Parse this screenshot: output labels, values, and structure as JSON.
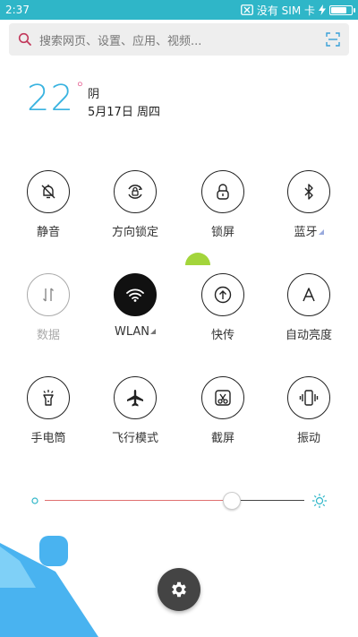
{
  "status_bar": {
    "time": "2:37",
    "sim_text": "没有 SIM 卡",
    "accent": "#2fb6c8",
    "battery_level_percent": 80
  },
  "search": {
    "placeholder": "搜索网页、设置、应用、视频..."
  },
  "weather": {
    "temperature": "22",
    "degree": "°",
    "condition": "阴",
    "date": "5月17日 周四"
  },
  "toggles": [
    {
      "label": "静音",
      "icon": "bell-off-icon",
      "state": "off"
    },
    {
      "label": "方向锁定",
      "icon": "rotation-lock-icon",
      "state": "off"
    },
    {
      "label": "锁屏",
      "icon": "lock-icon",
      "state": "off"
    },
    {
      "label": "蓝牙",
      "icon": "bluetooth-icon",
      "state": "off",
      "has_menu": true
    },
    {
      "label": "数据",
      "icon": "data-arrows-icon",
      "state": "disabled"
    },
    {
      "label": "WLAN",
      "icon": "wifi-icon",
      "state": "on",
      "has_menu": true
    },
    {
      "label": "快传",
      "icon": "share-up-icon",
      "state": "off"
    },
    {
      "label": "自动亮度",
      "icon": "auto-brightness-icon",
      "state": "off"
    },
    {
      "label": "手电筒",
      "icon": "flashlight-icon",
      "state": "off"
    },
    {
      "label": "飞行模式",
      "icon": "airplane-icon",
      "state": "off"
    },
    {
      "label": "截屏",
      "icon": "screenshot-icon",
      "state": "off"
    },
    {
      "label": "振动",
      "icon": "vibrate-icon",
      "state": "off"
    }
  ],
  "brightness": {
    "level_fraction": 0.72
  },
  "settings_button": {
    "icon": "gear-icon"
  }
}
